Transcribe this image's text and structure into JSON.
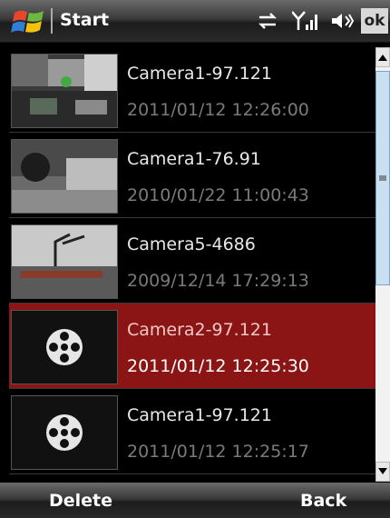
{
  "statusbar": {
    "title": "Start",
    "ok_label": "ok",
    "icons": [
      "windows-logo-icon",
      "connectivity-icon",
      "signal-icon",
      "speaker-icon"
    ]
  },
  "list": {
    "items": [
      {
        "name": "Camera1-97.121",
        "time": "2011/01/12 12:26:00",
        "thumb": "street-photo",
        "selected": false
      },
      {
        "name": "Camera1-76.91",
        "time": "2010/01/22 11:00:43",
        "thumb": "tunnel-photo",
        "selected": false
      },
      {
        "name": "Camera5-4686",
        "time": "2009/12/14 17:29:13",
        "thumb": "crane-photo",
        "selected": false
      },
      {
        "name": "Camera2-97.121",
        "time": "2011/01/12 12:25:30",
        "thumb": "film-reel-icon",
        "selected": true
      },
      {
        "name": "Camera1-97.121",
        "time": "2011/01/12 12:25:17",
        "thumb": "film-reel-icon",
        "selected": false
      }
    ]
  },
  "softkeys": {
    "left": "Delete",
    "right": "Back"
  },
  "colors": {
    "selected": "#8b1414",
    "scroll_thumb": "#c9dff2"
  }
}
